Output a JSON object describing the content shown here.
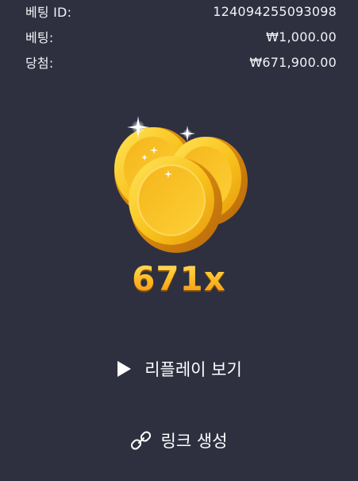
{
  "bet_info": {
    "id_label": "베팅 ID:",
    "id_value": "124094255093098",
    "bet_label": "베팅:",
    "bet_value": "₩1,000.00",
    "win_label": "당첨:",
    "win_value": "₩671,900.00"
  },
  "result": {
    "multiplier": "671x",
    "icon": "gold-coins-icon"
  },
  "actions": {
    "replay_label": "리플레이 보기",
    "replay_icon": "play-icon",
    "link_label": "링크 생성",
    "link_icon": "link-icon"
  },
  "colors": {
    "background": "#2e3040",
    "text": "#ffffff",
    "multiplier_gold": "#f4a81c",
    "coin_gold": "#f7c21c"
  }
}
